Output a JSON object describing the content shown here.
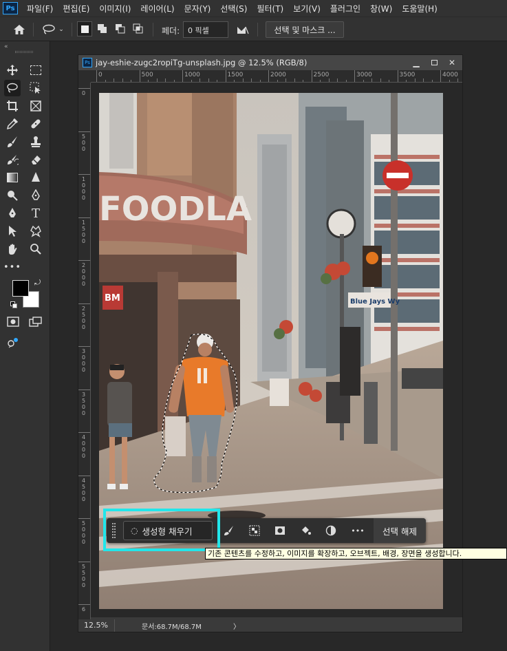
{
  "app": {
    "logo": "Ps"
  },
  "menu": [
    "파일(F)",
    "편집(E)",
    "이미지(I)",
    "레이어(L)",
    "문자(Y)",
    "선택(S)",
    "필터(T)",
    "보기(V)",
    "플러그인",
    "창(W)",
    "도움말(H)"
  ],
  "options": {
    "feather_label": "페더:",
    "feather_value": "0 픽셀",
    "mask_button": "선택 및 마스크 ..."
  },
  "document": {
    "title": "jay-eshie-zugc2ropiTg-unsplash.jpg @ 12.5% (RGB/8)",
    "zoom": "12.5%",
    "doc_info": "문서:68.7M/68.7M",
    "ruler_top": [
      "0",
      "500",
      "1000",
      "1500",
      "2000",
      "2500",
      "3000",
      "3500",
      "4000"
    ],
    "ruler_left": [
      "0",
      "5 0 0",
      "1 0 0 0",
      "1 5 0 0",
      "2 0 0 0",
      "2 5 0 0",
      "3 0 0 0",
      "3 5 0 0",
      "4 0 0 0",
      "4 5 0 0",
      "5 0 0 0",
      "5 5 0 0",
      "6"
    ]
  },
  "photo": {
    "sign_text": "FOODLA",
    "street_sign": "Blue Jays Wy",
    "shop_sign": "BM"
  },
  "taskbar": {
    "generative_fill": "생성형 채우기",
    "deselect": "선택 해제",
    "more": "•••"
  },
  "tooltip": "기존 콘텐츠를 수정하고, 이미지를 확장하고, 오브젝트, 배경, 장면을 생성합니다.",
  "colors": {
    "highlight": "#22e6ea",
    "ps_blue": "#31a8ff"
  }
}
